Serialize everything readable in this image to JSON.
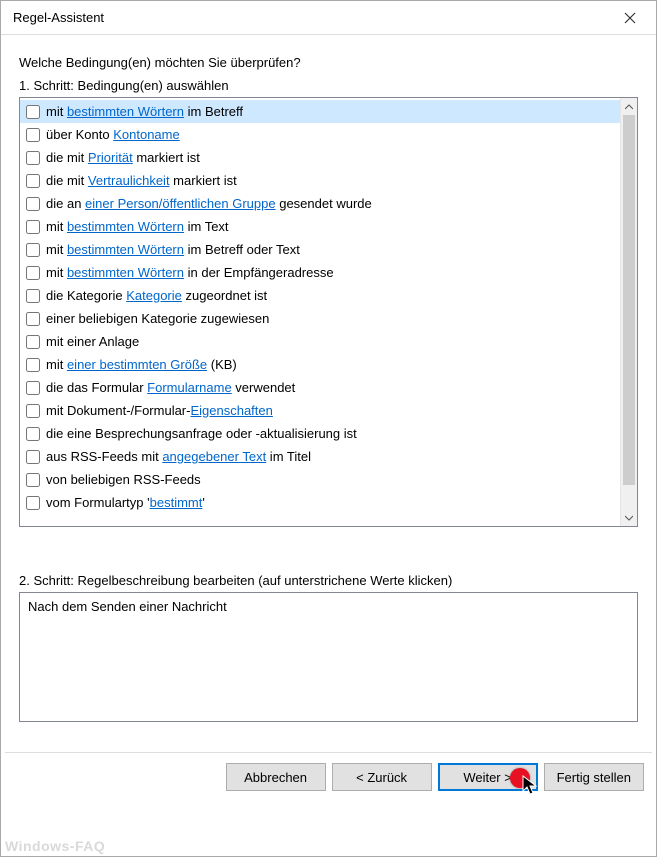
{
  "window": {
    "title": "Regel-Assistent"
  },
  "question": "Welche Bedingung(en) möchten Sie überprüfen?",
  "step1_label": "1. Schritt: Bedingung(en) auswählen",
  "conditions": [
    {
      "pre": "mit ",
      "link": "bestimmten Wörtern",
      "post": " im Betreff",
      "selected": true
    },
    {
      "pre": "über Konto ",
      "link": "Kontoname",
      "post": ""
    },
    {
      "pre": "die mit ",
      "link": "Priorität",
      "post": " markiert ist"
    },
    {
      "pre": "die mit ",
      "link": "Vertraulichkeit",
      "post": " markiert ist"
    },
    {
      "pre": "die an ",
      "link": "einer Person/öffentlichen Gruppe",
      "post": " gesendet wurde"
    },
    {
      "pre": "mit ",
      "link": "bestimmten Wörtern",
      "post": " im Text"
    },
    {
      "pre": "mit ",
      "link": "bestimmten Wörtern",
      "post": " im Betreff oder Text"
    },
    {
      "pre": "mit ",
      "link": "bestimmten Wörtern",
      "post": " in der Empfängeradresse"
    },
    {
      "pre": "die Kategorie ",
      "link": "Kategorie",
      "post": " zugeordnet ist"
    },
    {
      "pre": "einer beliebigen Kategorie zugewiesen",
      "link": "",
      "post": ""
    },
    {
      "pre": "mit einer Anlage",
      "link": "",
      "post": ""
    },
    {
      "pre": "mit ",
      "link": "einer bestimmten Größe",
      "post": " (KB)"
    },
    {
      "pre": "die das Formular ",
      "link": "Formularname",
      "post": " verwendet"
    },
    {
      "pre": "mit Dokument-/Formular-",
      "link": "Eigenschaften",
      "post": ""
    },
    {
      "pre": "die eine Besprechungsanfrage oder -aktualisierung ist",
      "link": "",
      "post": ""
    },
    {
      "pre": "aus RSS-Feeds mit ",
      "link": "angegebener Text",
      "post": " im Titel"
    },
    {
      "pre": "von beliebigen RSS-Feeds",
      "link": "",
      "post": ""
    },
    {
      "pre": "vom Formulartyp '",
      "link": "bestimmt",
      "post": "'"
    }
  ],
  "step2_label": "2. Schritt: Regelbeschreibung bearbeiten (auf unterstrichene Werte klicken)",
  "step2_text": "Nach dem Senden einer Nachricht",
  "buttons": {
    "cancel": "Abbrechen",
    "back": "< Zurück",
    "next": "Weiter >",
    "finish": "Fertig stellen"
  },
  "watermark": "Windows-FAQ"
}
